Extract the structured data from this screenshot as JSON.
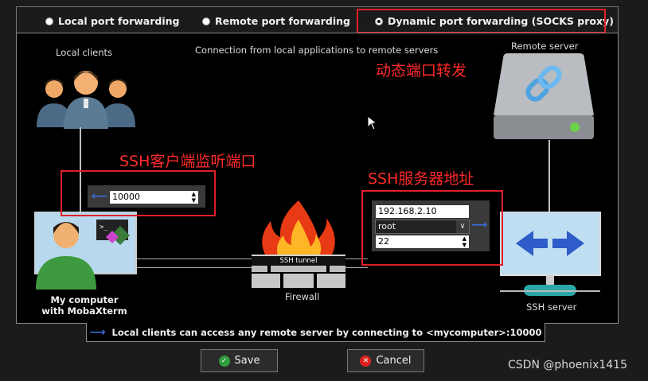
{
  "radio_options": [
    {
      "label": "Local port forwarding",
      "selected": false
    },
    {
      "label": "Remote port forwarding",
      "selected": false
    },
    {
      "label": "Dynamic port forwarding (SOCKS proxy)",
      "selected": true
    }
  ],
  "diagram": {
    "caption": "Connection from local applications to remote servers",
    "local_clients_label": "Local clients",
    "remote_server_label": "Remote server",
    "my_computer_label_line1": "My computer",
    "my_computer_label_line2": "with MobaXterm",
    "firewall_label": "Firewall",
    "ssh_tunnel_label": "SSH tunnel",
    "ssh_server_label": "SSH server",
    "local_port_value": "10000",
    "ssh_server_host": "192.168.2.10",
    "ssh_user": "root",
    "ssh_port": "22"
  },
  "annotations": {
    "dynamic_forwarding": "动态端口转发",
    "client_listen_port": "SSH客户端监听端口",
    "ssh_server_address": "SSH服务器地址"
  },
  "status_text": "Local clients can access any remote server by connecting to <mycomputer>:10000",
  "buttons": {
    "save": "Save",
    "cancel": "Cancel"
  },
  "watermark": "CSDN @phoenix1415",
  "colors": {
    "annotation_red": "#e0202a",
    "arrow_blue": "#3a5ccc",
    "save_green": "#2e9e3e",
    "cancel_red": "#d22"
  }
}
